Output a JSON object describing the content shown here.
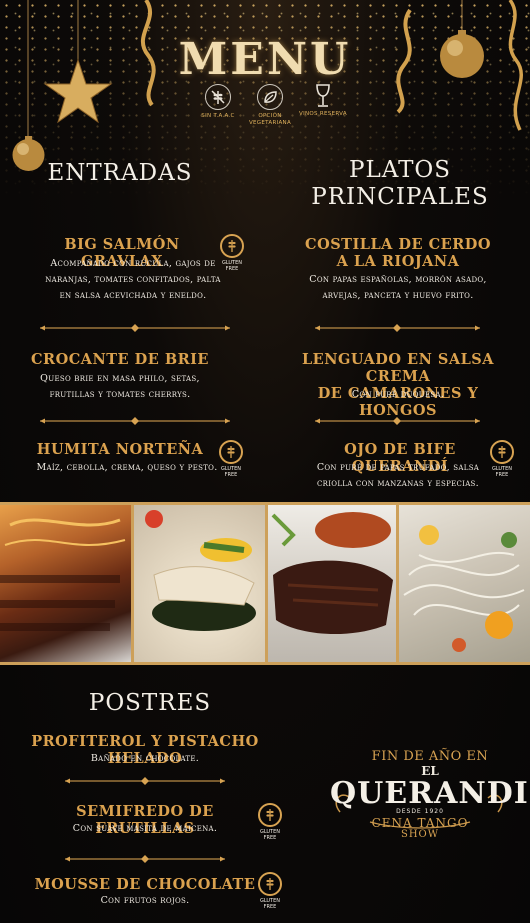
{
  "header": {
    "title": "MENU",
    "legend": [
      {
        "icon": "no-wheat-icon",
        "label": "SIN T.A.A.C"
      },
      {
        "icon": "leaf-icon",
        "label": "OPCIÓN VEGETARIANA"
      },
      {
        "icon": "wine-glass-icon",
        "label": "VINOS RESERVA"
      }
    ]
  },
  "gluten_free_label": "GLUTEN FREE",
  "entradas": {
    "title": "ENTRADAS",
    "items": [
      {
        "name": "BIG SALMÓN GRAVLAX",
        "desc_lines": [
          "Acompañado con rúcula, gajos de",
          "naranjas, tomates confitados, palta",
          "en salsa acevichada y eneldo."
        ]
      },
      {
        "name": "CROCANTE DE BRIE",
        "desc_lines": [
          "Queso brie en masa philo, setas,",
          "frutillas y tomates cherrys."
        ]
      },
      {
        "name": "HUMITA NORTEÑA",
        "desc_lines": [
          "Maíz, cebolla, crema, queso y pesto."
        ]
      }
    ]
  },
  "platos": {
    "title_lines": [
      "PLATOS",
      "PRINCIPALES"
    ],
    "items": [
      {
        "name_lines": [
          "COSTILLA DE CERDO",
          "A LA RIOJANA"
        ],
        "desc_lines": [
          "Con papas españolas, morrón asado,",
          "arvejas, panceta y huevo frito."
        ]
      },
      {
        "name_lines": [
          "LENGUADO EN SALSA CREMA",
          "DE CAMARONES Y HONGOS"
        ],
        "desc_lines": [
          "Con puré duquesa."
        ]
      },
      {
        "name_lines": [
          "OJO DE BIFE QUERANDÍ"
        ],
        "desc_lines": [
          "Con puré de papas trufado, salsa",
          "criolla con manzanas y especias."
        ]
      }
    ]
  },
  "postres": {
    "title": "POSTRES",
    "items": [
      {
        "name": "PROFITEROL Y PISTACHO HELADO",
        "desc": "Bañado en chocolate."
      },
      {
        "name": "SEMIFREDO DE FRUTILLAS",
        "desc": "Con suave masita de maicena."
      },
      {
        "name": "MOUSSE DE CHOCOLATE",
        "desc": "Con frutos rojos."
      }
    ]
  },
  "brand": {
    "tagline": "FIN DE AÑO EN",
    "article": "EL",
    "name": "QUERANDI",
    "since": "DESDE 1920",
    "line1": "CENA TANGO",
    "line2": "SHOW"
  }
}
